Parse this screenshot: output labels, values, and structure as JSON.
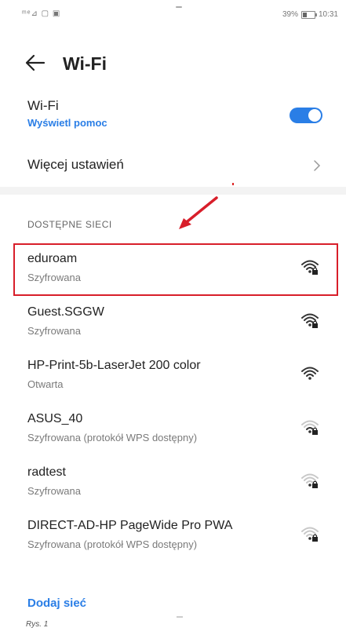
{
  "status": {
    "left_icons": "ᵐᵉ⊿ ▢ ▣",
    "battery": "39%",
    "time": "10:31"
  },
  "header": {
    "title": "Wi-Fi",
    "back_icon": "arrow-left-icon"
  },
  "wifi_toggle": {
    "title": "Wi-Fi",
    "help": "Wyświetl pomoc",
    "enabled": true,
    "accent": "#2a7ee6"
  },
  "more_settings": {
    "label": "Więcej ustawień"
  },
  "section": {
    "header": "DOSTĘPNE SIECI"
  },
  "networks": [
    {
      "name": "eduroam",
      "security": "Szyfrowana",
      "signal": 4,
      "locked": true,
      "highlighted": true
    },
    {
      "name": "Guest.SGGW",
      "security": "Szyfrowana",
      "signal": 4,
      "locked": true
    },
    {
      "name": "HP-Print-5b-LaserJet 200 color",
      "security": "Otwarta",
      "signal": 4,
      "locked": false
    },
    {
      "name": "ASUS_40",
      "security": "Szyfrowana (protokół WPS dostępny)",
      "signal": 2,
      "locked": true
    },
    {
      "name": "radtest",
      "security": "Szyfrowana",
      "signal": 1,
      "locked": true
    },
    {
      "name": "DIRECT-AD-HP PageWide Pro PWA",
      "security": "Szyfrowana (protokół WPS dostępny)",
      "signal": 1,
      "locked": true
    }
  ],
  "add_network": "Dodaj sieć",
  "caption": "Rys. 1",
  "colors": {
    "highlight": "#d81e2a",
    "arrow": "#d81e2a",
    "link": "#2a7ee6"
  }
}
